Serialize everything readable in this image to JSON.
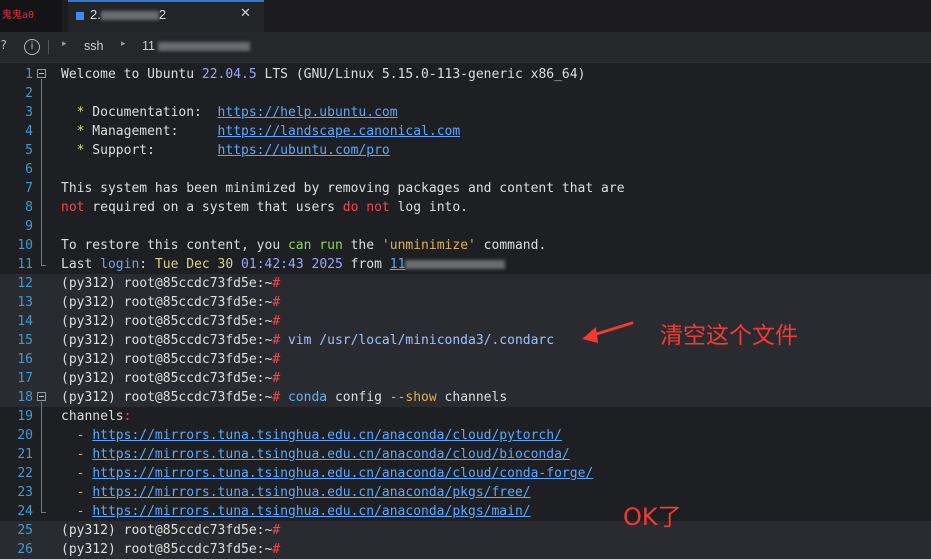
{
  "tabs": {
    "prev_label": "鬼鬼a0",
    "active_prefix": "2.",
    "active_suffix": "2",
    "close_glyph": "✕"
  },
  "breadcrumb": {
    "item1": "ssh",
    "item2": "11"
  },
  "terminal": {
    "lines": [
      {
        "n": "1",
        "fold": true,
        "segs": [
          {
            "t": "Welcome to Ubuntu "
          },
          {
            "t": "22.04.5",
            "c": "n"
          },
          {
            "t": " LTS (GNU/Linux 5.15.0-113-generic x86_64)"
          }
        ]
      },
      {
        "n": "2",
        "segs": []
      },
      {
        "n": "3",
        "segs": [
          {
            "t": "  "
          },
          {
            "t": "*",
            "c": "y"
          },
          {
            "t": " Documentation:  "
          },
          {
            "t": "https://help.ubuntu.com",
            "c": "u"
          }
        ]
      },
      {
        "n": "4",
        "segs": [
          {
            "t": "  "
          },
          {
            "t": "*",
            "c": "y"
          },
          {
            "t": " Management:     "
          },
          {
            "t": "https://landscape.canonical.com",
            "c": "u"
          }
        ]
      },
      {
        "n": "5",
        "segs": [
          {
            "t": "  "
          },
          {
            "t": "*",
            "c": "y"
          },
          {
            "t": " Support:        "
          },
          {
            "t": "https://ubuntu.com/pro",
            "c": "u"
          }
        ]
      },
      {
        "n": "6",
        "segs": []
      },
      {
        "n": "7",
        "segs": [
          {
            "t": "This system has been minimized by removing packages and content that are"
          }
        ]
      },
      {
        "n": "8",
        "segs": [
          {
            "t": "not",
            "c": "r"
          },
          {
            "t": " required on a system that users "
          },
          {
            "t": "do",
            "c": "r"
          },
          {
            "t": " "
          },
          {
            "t": "not",
            "c": "r"
          },
          {
            "t": " log into."
          }
        ]
      },
      {
        "n": "9",
        "segs": []
      },
      {
        "n": "10",
        "segs": [
          {
            "t": "To restore this content, you "
          },
          {
            "t": "can",
            "c": "g"
          },
          {
            "t": " "
          },
          {
            "t": "run",
            "c": "g"
          },
          {
            "t": " the "
          },
          {
            "t": "'unminimize'",
            "c": "o"
          },
          {
            "t": " command."
          }
        ]
      },
      {
        "n": "11",
        "segs": [
          {
            "t": "Last "
          },
          {
            "t": "login",
            "c": "b"
          },
          {
            "t": ": "
          },
          {
            "t": "Tue Dec 30",
            "c": "y"
          },
          {
            "t": " "
          },
          {
            "t": "01:42:43",
            "c": "n"
          },
          {
            "t": " "
          },
          {
            "t": "2025",
            "c": "n"
          },
          {
            "t": " from "
          },
          {
            "t": "11",
            "c": "u"
          }
        ]
      },
      {
        "n": "12",
        "hl": true,
        "segs": [
          {
            "t": "(py312) root@85ccdc73fd5e:~"
          },
          {
            "t": "#",
            "c": "p"
          }
        ]
      },
      {
        "n": "13",
        "hl": true,
        "segs": [
          {
            "t": "(py312) root@85ccdc73fd5e:~"
          },
          {
            "t": "#",
            "c": "p"
          }
        ]
      },
      {
        "n": "14",
        "hl": true,
        "segs": [
          {
            "t": "(py312) root@85ccdc73fd5e:~"
          },
          {
            "t": "#",
            "c": "p"
          }
        ]
      },
      {
        "n": "15",
        "hl": true,
        "segs": [
          {
            "t": "(py312) root@85ccdc73fd5e:~"
          },
          {
            "t": "#",
            "c": "p"
          },
          {
            "t": " vim /usr/local/miniconda3/.condarc",
            "c": "c"
          }
        ]
      },
      {
        "n": "16",
        "hl": true,
        "segs": [
          {
            "t": "(py312) root@85ccdc73fd5e:~"
          },
          {
            "t": "#",
            "c": "p"
          }
        ]
      },
      {
        "n": "17",
        "hl": true,
        "segs": [
          {
            "t": "(py312) root@85ccdc73fd5e:~"
          },
          {
            "t": "#",
            "c": "p"
          }
        ]
      },
      {
        "n": "18",
        "fold": true,
        "hl": true,
        "segs": [
          {
            "t": "(py312) root@85ccdc73fd5e:~"
          },
          {
            "t": "#",
            "c": "p"
          },
          {
            "t": " "
          },
          {
            "t": "conda",
            "c": "k"
          },
          {
            "t": " config "
          },
          {
            "t": "--show",
            "c": "o"
          },
          {
            "t": " channels"
          }
        ]
      },
      {
        "n": "19",
        "segs": [
          {
            "t": "channels"
          },
          {
            "t": ":",
            "c": "p"
          }
        ]
      },
      {
        "n": "20",
        "segs": [
          {
            "t": "  "
          },
          {
            "t": "-",
            "c": "o"
          },
          {
            "t": " "
          },
          {
            "t": "https://mirrors.tuna.tsinghua.edu.cn/anaconda/cloud/pytorch/",
            "c": "u"
          }
        ]
      },
      {
        "n": "21",
        "segs": [
          {
            "t": "  "
          },
          {
            "t": "-",
            "c": "o"
          },
          {
            "t": " "
          },
          {
            "t": "https://mirrors.tuna.tsinghua.edu.cn/anaconda/cloud/bioconda/",
            "c": "u"
          }
        ]
      },
      {
        "n": "22",
        "segs": [
          {
            "t": "  "
          },
          {
            "t": "-",
            "c": "o"
          },
          {
            "t": " "
          },
          {
            "t": "https://mirrors.tuna.tsinghua.edu.cn/anaconda/cloud/conda-forge/",
            "c": "u"
          }
        ]
      },
      {
        "n": "23",
        "segs": [
          {
            "t": "  "
          },
          {
            "t": "-",
            "c": "o"
          },
          {
            "t": " "
          },
          {
            "t": "https://mirrors.tuna.tsinghua.edu.cn/anaconda/pkgs/free/",
            "c": "u"
          }
        ]
      },
      {
        "n": "24",
        "segs": [
          {
            "t": "  "
          },
          {
            "t": "-",
            "c": "o"
          },
          {
            "t": " "
          },
          {
            "t": "https://mirrors.tuna.tsinghua.edu.cn/anaconda/pkgs/main/",
            "c": "u"
          }
        ]
      },
      {
        "n": "25",
        "hl": true,
        "segs": [
          {
            "t": "(py312) root@85ccdc73fd5e:~"
          },
          {
            "t": "#",
            "c": "p"
          }
        ]
      },
      {
        "n": "26",
        "hl": true,
        "segs": [
          {
            "t": "(py312) root@85ccdc73fd5e:~"
          },
          {
            "t": "#",
            "c": "p"
          }
        ]
      }
    ]
  },
  "annotations": {
    "clear_file": "清空这个文件",
    "ok": "OK了"
  },
  "colors": {
    "annotation": "#f23b30",
    "line_number": "#3f9bd3",
    "tab_accent": "#2f7bd6"
  }
}
